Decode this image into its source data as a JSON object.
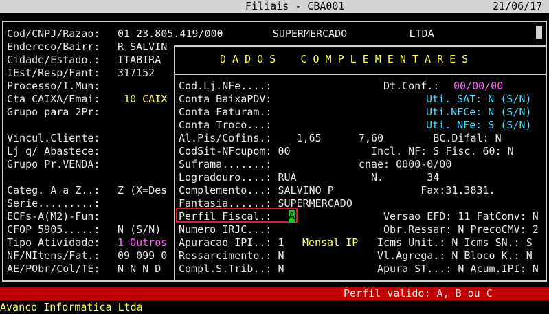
{
  "header": {
    "title": "Filiais - CBA001",
    "date": "21/06/17"
  },
  "left_panel": {
    "rows": [
      {
        "label": "Cod/CNPJ/Razao:",
        "value": " 01 23.805.419/000        SUPERMERCADO          LTDA"
      },
      {
        "label": "Endereco/Bairr:",
        "value": " R SALVIN"
      },
      {
        "label": "Cidade/Estado.:",
        "value": " ITABIRA"
      },
      {
        "label": "IEst/Resp/Fant:",
        "value": " 317152"
      },
      {
        "label": "Processo/I.Mun:",
        "value": ""
      },
      {
        "label": "Cta CAIXA/Emai:",
        "value": "  10 CAIX"
      },
      {
        "label": "Grupo para 2Pr:",
        "value": ""
      },
      {
        "label": "",
        "value": ""
      },
      {
        "label": "Vincul.Cliente:",
        "value": ""
      },
      {
        "label": "Lj q/ Abastece:",
        "value": ""
      },
      {
        "label": "Grupo Pr.VENDA:",
        "value": ""
      },
      {
        "label": "",
        "value": ""
      },
      {
        "label": "Categ. A a Z..:",
        "value": " Z (X=Des"
      },
      {
        "label": "Serie.........:",
        "value": ""
      },
      {
        "label": "ECFs-A(M2)-Fun:",
        "value": ""
      },
      {
        "label": "CFOP 5905.....:",
        "value": " N (S/N)"
      },
      {
        "label": "Tipo Atividade:",
        "value": " 1 Outros"
      },
      {
        "label": "NF/NItens/Fat.:",
        "value": " 09 099 0"
      },
      {
        "label": "AE/PObr/Col/TE:",
        "value": " N N N D"
      }
    ]
  },
  "dialog": {
    "title": "D A D O S    C O M P L E M E N T A R E S",
    "rows": [
      "Cod.Lj.NFe....:                  Dt.Conf.: ",
      "Conta BaixaPDV:                          ",
      "Conta Faturam.:                          ",
      "Conta Troco...:                          ",
      "Al.Pis/Cofins.:    1,65      7,60        BC.Difal: N",
      "CodSit-NFcupom: 00             Incl. NF: S Fisc. 60: N",
      "Suframa.......:              cnae: 0000-0/00",
      "Logradouro....: RUA            N.       34",
      "Complemento...: SALVINO P              Fax:31.3831.",
      "Fantasia......: SUPERMERCADO",
      "Perfil Fiscal.:                  Versao EFD: 11 FatConv: N",
      "Numero IRJC...:                  Obr.Ressar: N PrecoCMV: 2",
      "Apuracao IPI..: 1               Icms Unit.: N Icms SN.: S",
      "Ressarcimento.: N               Vl.Agrega.: N Bloco K.: N",
      "Compl.S.Trib..: N               Apura ST...: N Acum.IPI: N"
    ],
    "dt_conf": "00/00/00",
    "uti_sat": "Uti. SAT: N (S/N)",
    "uti_nfce": "Uti.NFCe: N (S/N)",
    "uti_nfe": "Uti. NFe: S (S/N)",
    "perfil_value": "A",
    "apuracao_label": "Mensal IP"
  },
  "status": {
    "message": "Perfil valido: A, B ou C"
  },
  "footer": {
    "company": "Avanco Informatica Ltda"
  }
}
